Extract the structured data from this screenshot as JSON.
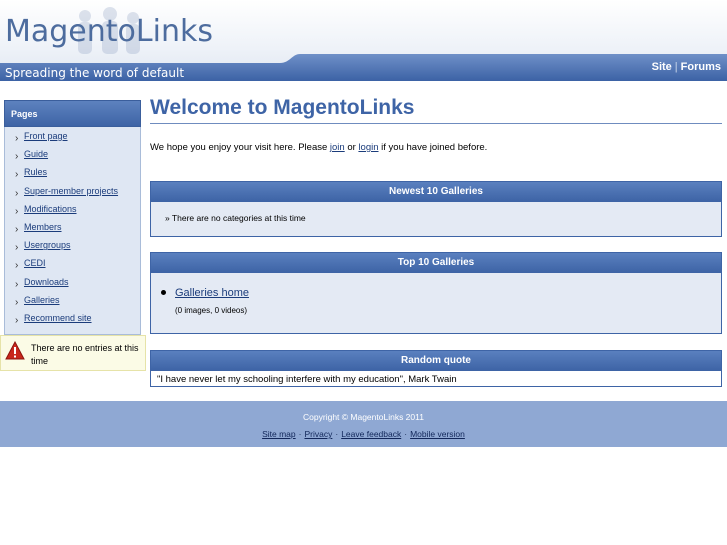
{
  "header": {
    "site_title": "MagentoLinks",
    "tagline": "Spreading the word of default",
    "links": [
      "Site",
      "Forums"
    ]
  },
  "sidebar": {
    "heading": "Pages",
    "items": [
      {
        "label": "Front page"
      },
      {
        "label": "Guide"
      },
      {
        "label": "Rules"
      },
      {
        "label": "Super-member projects"
      },
      {
        "label": "Modifications"
      },
      {
        "label": "Members"
      },
      {
        "label": "Usergroups"
      },
      {
        "label": "CEDI"
      },
      {
        "label": "Downloads"
      },
      {
        "label": "Galleries"
      },
      {
        "label": "Recommend site"
      }
    ],
    "warning": "There are no entries at this time"
  },
  "main": {
    "title": "Welcome to MagentoLinks",
    "welcome_before": "We hope you enjoy your visit here. Please ",
    "join_link": "join",
    "welcome_or": " or ",
    "login_link": "login",
    "welcome_after": " if you have joined before."
  },
  "panels": {
    "newest": {
      "heading": "Newest 10 Galleries",
      "text": "» There are no categories at this time"
    },
    "top": {
      "heading": "Top 10 Galleries",
      "link": "Galleries home",
      "sub": "(0 images, 0 videos)"
    },
    "quote": {
      "heading": "Random quote",
      "text": "\"I have never let my schooling interfere with my education\", Mark Twain"
    }
  },
  "footer": {
    "copyright": "Copyright © MagentoLinks 2011",
    "links": [
      "Site map",
      "Privacy",
      "Leave feedback",
      "Mobile version"
    ]
  },
  "colors": {
    "brand_blue": "#3e64a6",
    "footer_blue": "#8fa8d3",
    "panel_bg": "#e4eaf4"
  }
}
